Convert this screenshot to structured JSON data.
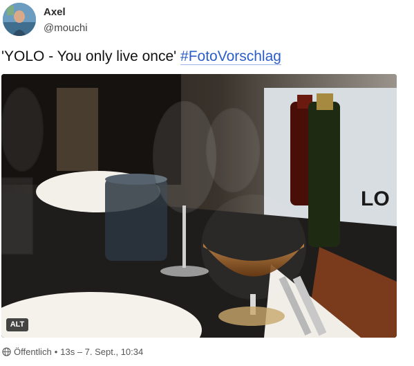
{
  "post": {
    "author": {
      "display_name": "Axel",
      "handle": "@mouchi",
      "avatar_icon": "avatar-photo"
    },
    "text": "'YOLO - You only live once' ",
    "hashtag": "#FotoVorschlag",
    "media": {
      "alt_badge": "ALT"
    },
    "footer": {
      "visibility_icon": "globe-icon",
      "visibility": "Öffentlich",
      "separator": "•",
      "timestamp": "13s – 7. Sept., 10:34"
    }
  },
  "colors": {
    "hashtag": "#2b5dc9",
    "background": "#ffffff"
  }
}
